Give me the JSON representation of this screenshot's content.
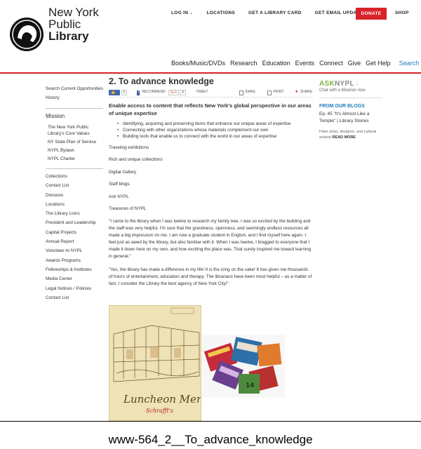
{
  "header": {
    "logo_lines": [
      "New York",
      "Public",
      "Library"
    ],
    "top_nav": [
      "LOG IN",
      "LOCATIONS",
      "GET A LIBRARY CARD",
      "GET EMAIL UPDATES"
    ],
    "donate": "DONATE",
    "shop": "SHOP",
    "main_nav": [
      "Books/Music/DVDs",
      "Research",
      "Education",
      "Events",
      "Connect",
      "Give",
      "Get Help"
    ],
    "search": "Search",
    "accent_color": "#d8232a",
    "link_color": "#1b7cbc"
  },
  "sidebar": {
    "top_items": [
      "Search Current Opportunities",
      "History"
    ],
    "mission": "Mission",
    "mission_items": [
      "The New York Public Library's Core Values",
      "NY State Plan of Service",
      "NYPL Bylaws",
      "NYPL Charter"
    ],
    "links": [
      "Collections",
      "Contact List",
      "Divisions",
      "Locations",
      "The Library Lions",
      "President and Leadership",
      "Capital Projects",
      "Annual Report",
      "Volunteer At NYPL",
      "Awards Programs",
      "Fellowships & Institutes",
      "Media Center",
      "Legal Notices / Policies",
      "Contact List"
    ]
  },
  "main": {
    "title": "2. To advance knowledge",
    "share": {
      "like": "Like",
      "like_count": "0",
      "recommend": "RECOMMEND",
      "gplus": "G+1",
      "gplus_count": "0",
      "tweet": "TWEET",
      "email": "EMAIL",
      "print": "PRINT",
      "share": "SHARE"
    },
    "lede": "Enable access to content that reflects New York's global perspective in our areas of unique expertise",
    "bullets": [
      "Identifying, acquiring and preserving items that enhance our unique areas of expertise",
      "Connecting with other organizations whose materials complement our own",
      "Building tools that enable us to connect with the world in our areas of expertise"
    ],
    "paragraphs": [
      "Traveling exhibitions",
      "Rich and unique collections",
      "Digital Gallery",
      "Staff blogs",
      "Ask NYPL",
      "Treasures of NYPL"
    ],
    "quotes": [
      "\"I came to the library when I was twelve to research my family tree. I was so excited by the building and the staff was very helpful. I'm sure that the grandness, openness, and seemingly endless resources all made a big impression on me. I am now a graduate student in English, and I find myself here again. I feel just as awed by the library, but also familiar with it. When I was twelve, I bragged to everyone that I made it down here on my own, and how exciting the place was. That surely inspired me toward learning in general.\"",
      "\"Yes, the library has made a difference in my life! It is the icing on the cake! It has given me thousands of hours of entertainment, education and therapy. The librarians have been most helpful – as a matter of fact, I consider the Library the best agency of New York City!\""
    ],
    "menu_image_text": "Luncheon Menu",
    "menu_image_sub": "Schrafft's",
    "books_image_label": "14"
  },
  "right": {
    "ask": "ASK",
    "ask_nypl": "NYPL",
    "ask_sub": "Chat with a librarian now",
    "blogs_heading": "FROM OUR BLOGS",
    "blog_title": "Ep. 45 \"It's Almost Like a Temple\" | Library Stories",
    "blog_desc": "Fiber artist, designer, and cultural activist",
    "read_more": "READ MORE"
  },
  "caption": "www-564_2__To_advance_knowledge"
}
